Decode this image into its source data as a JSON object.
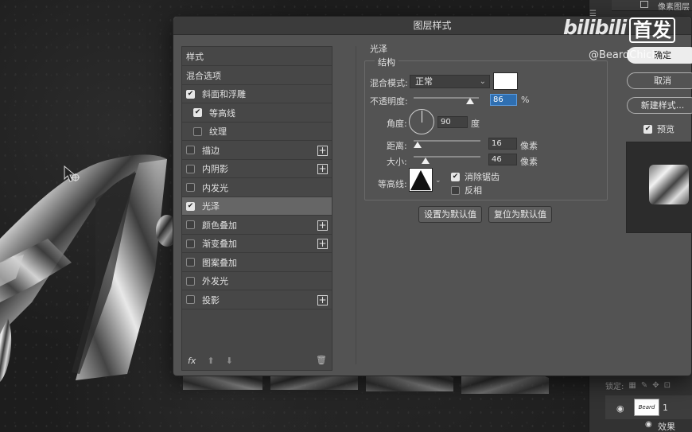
{
  "dialog": {
    "title": "图层样式"
  },
  "style_list": {
    "items": [
      {
        "label": "样式",
        "checkbox": false,
        "checked": false,
        "plus": false
      },
      {
        "label": "混合选项",
        "checkbox": false,
        "checked": false,
        "plus": false
      },
      {
        "label": "斜面和浮雕",
        "checkbox": true,
        "checked": true,
        "plus": false
      },
      {
        "label": "等高线",
        "checkbox": true,
        "checked": true,
        "plus": false,
        "indent": true
      },
      {
        "label": "纹理",
        "checkbox": true,
        "checked": false,
        "plus": false,
        "indent": true
      },
      {
        "label": "描边",
        "checkbox": true,
        "checked": false,
        "plus": true
      },
      {
        "label": "内阴影",
        "checkbox": true,
        "checked": false,
        "plus": true
      },
      {
        "label": "内发光",
        "checkbox": true,
        "checked": false,
        "plus": false
      },
      {
        "label": "光泽",
        "checkbox": true,
        "checked": true,
        "plus": false,
        "selected": true
      },
      {
        "label": "颜色叠加",
        "checkbox": true,
        "checked": false,
        "plus": true
      },
      {
        "label": "渐变叠加",
        "checkbox": true,
        "checked": false,
        "plus": true
      },
      {
        "label": "图案叠加",
        "checkbox": true,
        "checked": false,
        "plus": false
      },
      {
        "label": "外发光",
        "checkbox": true,
        "checked": false,
        "plus": false
      },
      {
        "label": "投影",
        "checkbox": true,
        "checked": false,
        "plus": true
      }
    ],
    "footer_fx": "fx"
  },
  "satin": {
    "section_title": "光泽",
    "group_title": "结构",
    "blend_mode_label": "混合模式:",
    "blend_mode_value": "正常",
    "opacity_label": "不透明度:",
    "opacity_value": "86",
    "opacity_unit": "%",
    "angle_label": "角度:",
    "angle_value": "90",
    "angle_unit": "度",
    "distance_label": "距离:",
    "distance_value": "16",
    "distance_unit": "像素",
    "size_label": "大小:",
    "size_value": "46",
    "size_unit": "像素",
    "contour_label": "等高线:",
    "antialias_label": "消除锯齿",
    "antialias_checked": true,
    "invert_label": "反相",
    "invert_checked": false,
    "make_default": "设置为默认值",
    "reset_default": "复位为默认值",
    "color": "#ffffff"
  },
  "side_buttons": {
    "ok": "确定",
    "cancel": "取消",
    "new_style": "新建样式...",
    "preview_label": "预览",
    "preview_checked": true
  },
  "layers_panel": {
    "top_layer": "像素图层",
    "lock_label": "锁定:",
    "layer_name": "1",
    "thumb_text": "Beard",
    "effects_label": "效果"
  },
  "watermark": {
    "logo": "bilibili",
    "tag": "首发",
    "user": "@BeardChick"
  }
}
